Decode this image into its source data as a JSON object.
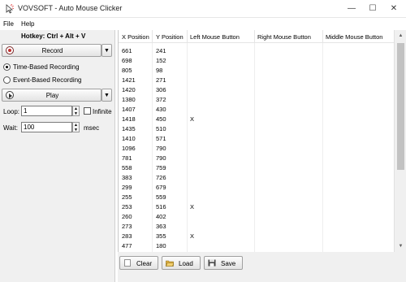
{
  "window": {
    "title": "VOVSOFT - Auto Mouse Clicker",
    "controls": {
      "minimize": "—",
      "maximize": "☐",
      "close": "✕"
    }
  },
  "menu": {
    "file": "File",
    "help": "Help"
  },
  "left": {
    "hotkey": "Hotkey: Ctrl + Alt + V",
    "record_label": "Record",
    "radio_time": "Time-Based Recording",
    "radio_event": "Event-Based Recording",
    "selected_mode": "time",
    "play_label": "Play",
    "loop_label": "Loop:",
    "loop_value": "1",
    "infinite_label": "Infinite",
    "infinite_checked": false,
    "wait_label": "Wait:",
    "wait_value": "100",
    "wait_unit": "msec"
  },
  "table": {
    "columns": [
      "X Position",
      "Y Position",
      "Left Mouse Button",
      "Right Mouse Button",
      "Middle Mouse Button"
    ],
    "rows": [
      [
        "661",
        "241",
        "",
        "",
        ""
      ],
      [
        "698",
        "152",
        "",
        "",
        ""
      ],
      [
        "805",
        "98",
        "",
        "",
        ""
      ],
      [
        "1421",
        "271",
        "",
        "",
        ""
      ],
      [
        "1420",
        "306",
        "",
        "",
        ""
      ],
      [
        "1380",
        "372",
        "",
        "",
        ""
      ],
      [
        "1407",
        "430",
        "",
        "",
        ""
      ],
      [
        "1418",
        "450",
        "X",
        "",
        ""
      ],
      [
        "1435",
        "510",
        "",
        "",
        ""
      ],
      [
        "1410",
        "571",
        "",
        "",
        ""
      ],
      [
        "1096",
        "790",
        "",
        "",
        ""
      ],
      [
        "781",
        "790",
        "",
        "",
        ""
      ],
      [
        "558",
        "759",
        "",
        "",
        ""
      ],
      [
        "383",
        "726",
        "",
        "",
        ""
      ],
      [
        "299",
        "679",
        "",
        "",
        ""
      ],
      [
        "255",
        "559",
        "",
        "",
        ""
      ],
      [
        "253",
        "516",
        "X",
        "",
        ""
      ],
      [
        "260",
        "402",
        "",
        "",
        ""
      ],
      [
        "273",
        "363",
        "",
        "",
        ""
      ],
      [
        "283",
        "355",
        "X",
        "",
        ""
      ],
      [
        "477",
        "180",
        "",
        "",
        ""
      ]
    ]
  },
  "bottom": {
    "clear_label": "Clear",
    "load_label": "Load",
    "save_label": "Save"
  },
  "colors": {
    "record_accent": "#c03030",
    "load_folder": "#e0b040",
    "save_disk": "#444444"
  }
}
